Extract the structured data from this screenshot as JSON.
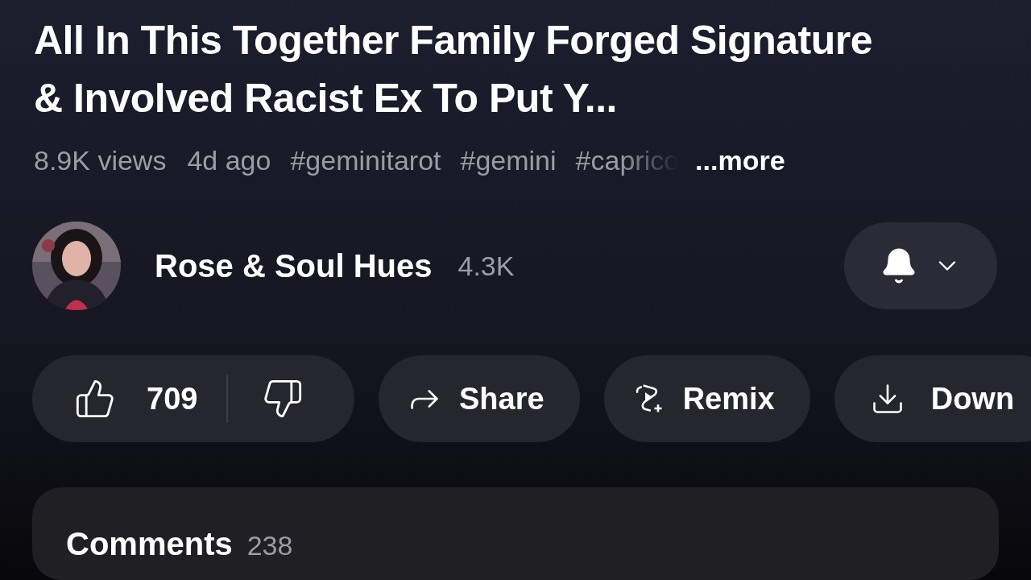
{
  "video": {
    "title": "All In This Together Family Forged Signature & Involved Racist Ex To Put Y...",
    "views": "8.9K views",
    "age": "4d ago",
    "hashtags": [
      "#geminitarot",
      "#gemini",
      "#caprico"
    ],
    "more": "...more"
  },
  "channel": {
    "name": "Rose & Soul Hues",
    "subscribers": "4.3K"
  },
  "actions": [
    {
      "kind": "like",
      "label": "709"
    },
    {
      "kind": "share",
      "label": "Share"
    },
    {
      "kind": "remix",
      "label": "Remix"
    },
    {
      "kind": "download",
      "label": "Down"
    }
  ],
  "comments": {
    "title": "Comments",
    "count": "238"
  }
}
